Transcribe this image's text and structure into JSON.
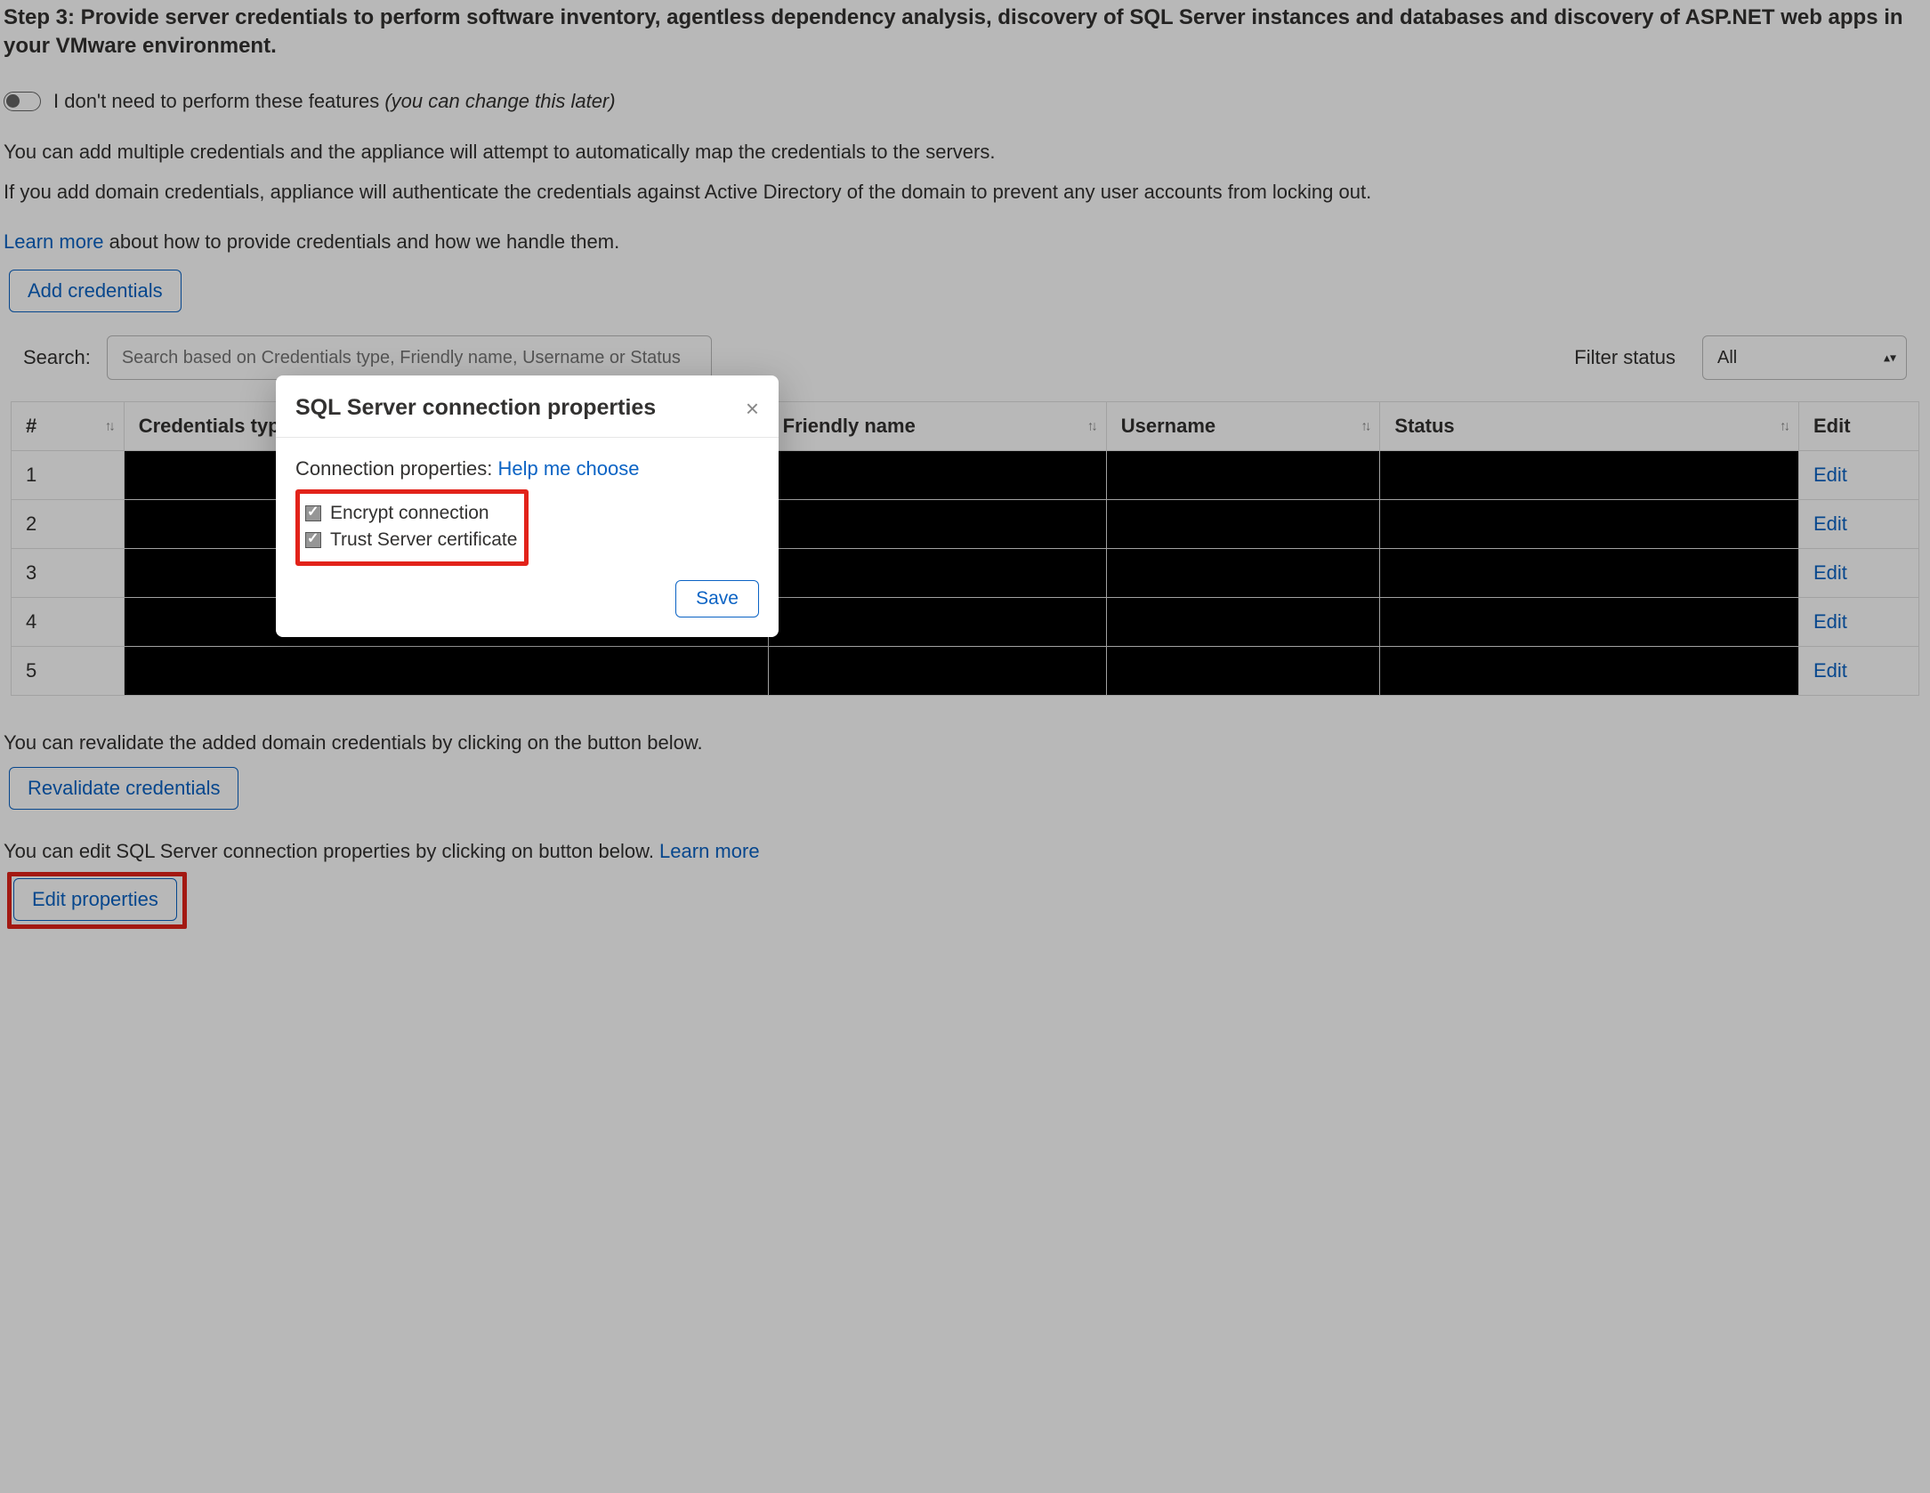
{
  "step_title": "Step 3: Provide server credentials to perform software inventory, agentless dependency analysis, discovery of SQL Server instances and databases and discovery of ASP.NET web apps in your VMware environment.",
  "toggle": {
    "label_main": "I don't need to perform these features ",
    "label_note": "(you can change this later)"
  },
  "info_text_1": "You can add multiple credentials and the appliance will attempt to automatically map the credentials to the servers.",
  "info_text_2": "If you add domain credentials, appliance will authenticate the credentials against Active Directory of the domain to prevent any user accounts from locking out.",
  "learn_more": {
    "link": "Learn more",
    "rest": " about how to provide credentials and how we handle them."
  },
  "add_credentials_btn": "Add credentials",
  "search": {
    "label": "Search:",
    "placeholder": "Search based on Credentials type, Friendly name, Username or Status"
  },
  "filter": {
    "label": "Filter status",
    "selected": "All"
  },
  "table": {
    "headers": {
      "num": "#",
      "type": "Credentials type",
      "friendly": "Friendly name",
      "user": "Username",
      "status": "Status",
      "edit": "Edit"
    },
    "rows": [
      {
        "n": "1",
        "edit": "Edit"
      },
      {
        "n": "2",
        "edit": "Edit"
      },
      {
        "n": "3",
        "edit": "Edit"
      },
      {
        "n": "4",
        "edit": "Edit"
      },
      {
        "n": "5",
        "edit": "Edit"
      }
    ]
  },
  "revalidate_text": "You can revalidate the added domain credentials by clicking on the button below.",
  "revalidate_btn": "Revalidate credentials",
  "edit_props_text": "You can edit SQL Server connection properties by clicking on button below. ",
  "edit_props_learn": "Learn more",
  "edit_props_btn": "Edit properties",
  "modal": {
    "title": "SQL Server connection properties",
    "close": "×",
    "conn_label": "Connection properties: ",
    "help_link": "Help me choose",
    "opt_encrypt": "Encrypt connection",
    "opt_trust": "Trust Server certificate",
    "save": "Save"
  }
}
